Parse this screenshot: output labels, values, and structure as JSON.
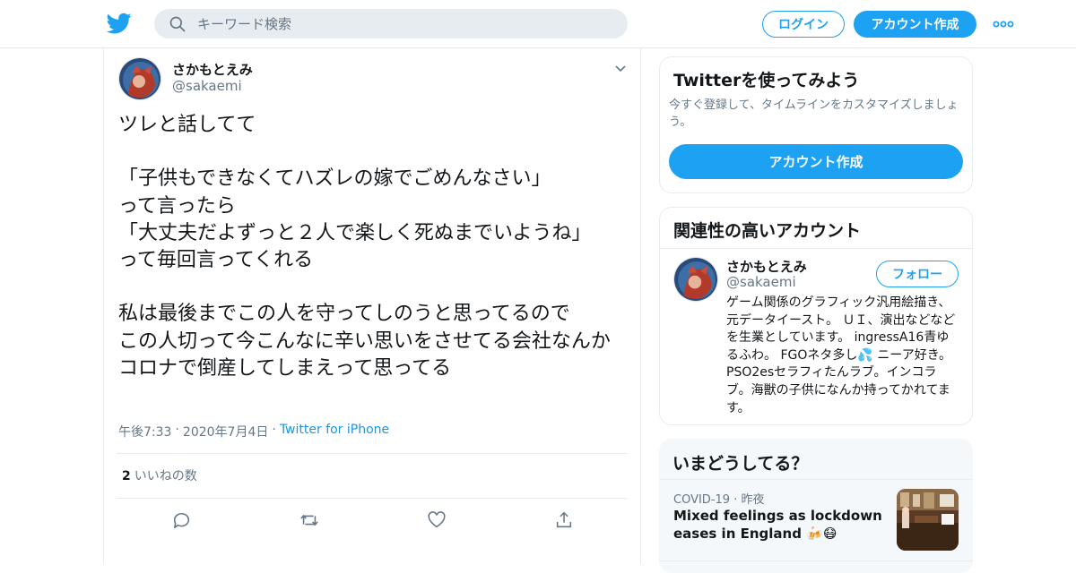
{
  "header": {
    "logo_icon": "twitter-bird-icon",
    "search_placeholder": "キーワード検索",
    "login_label": "ログイン",
    "signup_label": "アカウント作成",
    "more_icon": "more-dots-icon",
    "brand_color": "#1da1f2"
  },
  "tweet": {
    "author_name": "さかもとえみ",
    "author_handle": "@sakaemi",
    "text": "ツレと話してて\n\n「子供もできなくてハズレの嫁でごめんなさい」\nって言ったら\n「大丈夫だよずっと２人で楽しく死ぬまでいようね」\nって毎回言ってくれる\n\n私は最後までこの人を守ってしのうと思ってるので\nこの人切って今こんなに辛い思いをさせてる会社なんか\nコロナで倒産してしまえって思ってる",
    "time": "午後7:33",
    "date": "2020年7月4日",
    "source": "Twitter for iPhone",
    "like_count": "2",
    "like_label": "いいねの数"
  },
  "signup_card": {
    "title": "Twitterを使ってみよう",
    "description": "今すぐ登録して、タイムラインをカスタマイズしましょう。",
    "button_label": "アカウント作成"
  },
  "related_card": {
    "title": "関連性の高いアカウント",
    "name": "さかもとえみ",
    "handle": "@sakaemi",
    "follow_label": "フォロー",
    "bio": "ゲーム関係のグラフィック汎用絵描き、元データイースト。 ＵＩ、演出などなどを生業としています。 ingressA16青ゆるふわ。 FGOネタ多し💦 ニーア好き。PSO2esセラフィたんラブ。インコラブ。海獣の子供になんか持ってかれてます。"
  },
  "trends_card": {
    "title": "いまどうしてる？",
    "trend_category": "COVID-19",
    "trend_time": "昨夜",
    "trend_text": "Mixed feelings as lockdown eases in England 🍻😷"
  }
}
